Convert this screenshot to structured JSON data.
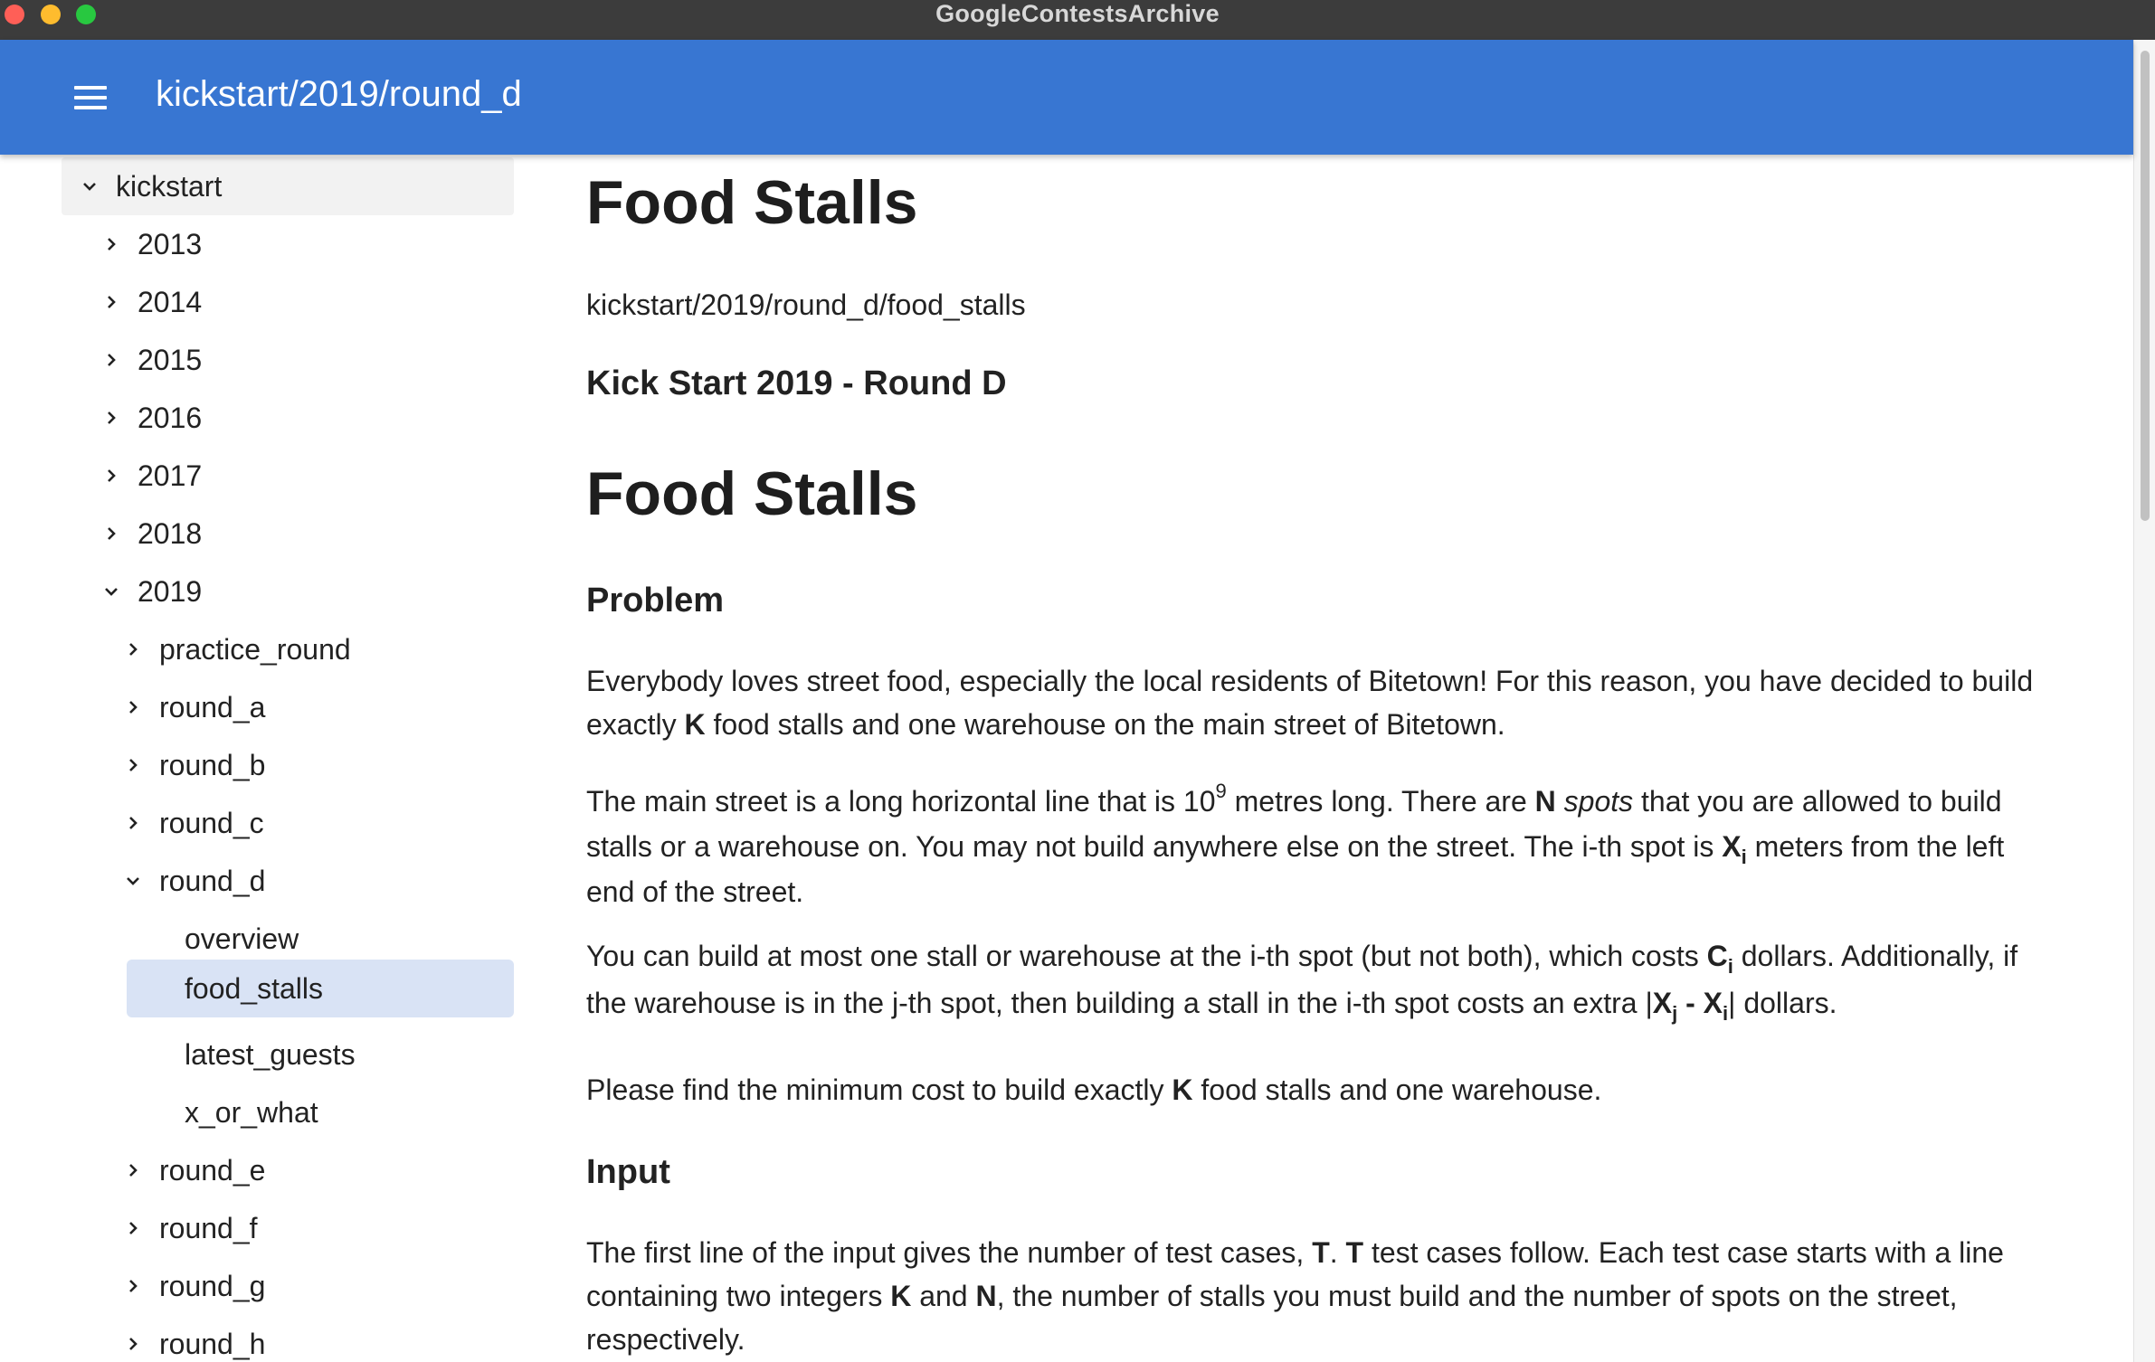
{
  "window": {
    "title": "GoogleContestsArchive"
  },
  "appbar": {
    "title": "kickstart/2019/round_d"
  },
  "sidebar": {
    "root": {
      "label": "kickstart",
      "expanded": true
    },
    "years": [
      {
        "label": "2013",
        "expanded": false
      },
      {
        "label": "2014",
        "expanded": false
      },
      {
        "label": "2015",
        "expanded": false
      },
      {
        "label": "2016",
        "expanded": false
      },
      {
        "label": "2017",
        "expanded": false
      },
      {
        "label": "2018",
        "expanded": false
      },
      {
        "label": "2019",
        "expanded": true
      }
    ],
    "rounds_before": [
      {
        "label": "practice_round"
      },
      {
        "label": "round_a"
      },
      {
        "label": "round_b"
      },
      {
        "label": "round_c"
      }
    ],
    "current_round": {
      "label": "round_d",
      "expanded": true
    },
    "problems": [
      {
        "label": "overview",
        "selected": false
      },
      {
        "label": "food_stalls",
        "selected": true
      },
      {
        "label": "latest_guests",
        "selected": false
      },
      {
        "label": "x_or_what",
        "selected": false
      }
    ],
    "rounds_after": [
      {
        "label": "round_e"
      },
      {
        "label": "round_f"
      },
      {
        "label": "round_g"
      },
      {
        "label": "round_h"
      }
    ]
  },
  "content": {
    "page_title": "Food Stalls",
    "path": "kickstart/2019/round_d/food_stalls",
    "contest_name": "Kick Start 2019 - Round D",
    "problem_title": "Food Stalls",
    "problem_heading": "Problem",
    "p1": {
      "a": "Everybody loves street food, especially the local residents of Bitetown! For this reason, you have decided to build exactly ",
      "k": "K",
      "b": " food stalls and one warehouse on the main street of Bitetown."
    },
    "p2": {
      "a": "The main street is a long horizontal line that is 10",
      "exp": "9",
      "b": " metres long. There are ",
      "n": "N",
      "c": " ",
      "spots": "spots",
      "d": " that you are allowed to build stalls or a warehouse on. You may not build anywhere else on the street. The i-th spot is ",
      "x": "X",
      "i": "i",
      "e": " meters from the left end of the street."
    },
    "p3": {
      "a": "You can build at most one stall or warehouse at the i-th spot (but not both), which costs ",
      "c": "C",
      "ci": "i",
      "b": " dollars. Additionally, if the warehouse is in the j-th spot, then building a stall in the i-th spot costs an extra |",
      "xj": "X",
      "j": "j",
      "dash": " - ",
      "xi": "X",
      "i": "i",
      "d": "| dollars."
    },
    "p4": {
      "a": "Please find the minimum cost to build exactly ",
      "k": "K",
      "b": " food stalls and one warehouse."
    },
    "input_heading": "Input",
    "p5": {
      "a": "The first line of the input gives the number of test cases, ",
      "t1": "T",
      "dot": ". ",
      "t2": "T",
      "b": " test cases follow. Each test case starts with a line containing two integers ",
      "k": "K",
      "and": " and ",
      "n": "N",
      "c": ", the number of stalls you must build and the number of spots on the street, respectively."
    }
  },
  "colors": {
    "appbar": "#3876d2",
    "selected_row": "#d9e3f5",
    "titlebar": "#3c3c3c"
  }
}
